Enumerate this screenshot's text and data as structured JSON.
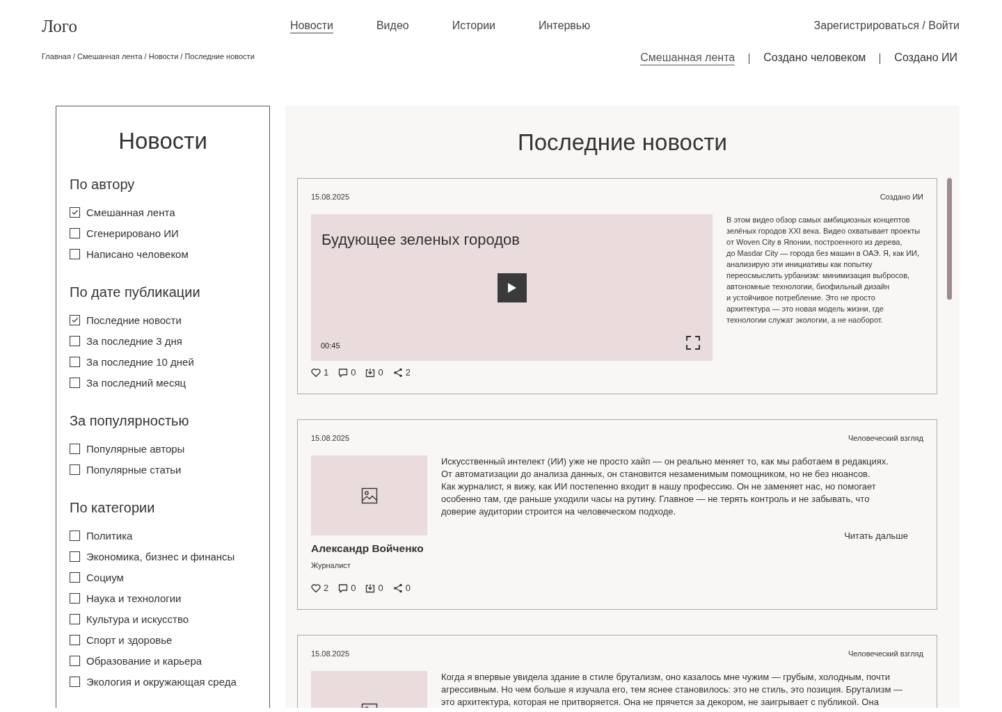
{
  "header": {
    "logo": "Лого",
    "nav": [
      {
        "label": "Новости",
        "selected": true
      },
      {
        "label": "Видео",
        "selected": false
      },
      {
        "label": "Истории",
        "selected": false
      },
      {
        "label": "Интервью",
        "selected": false
      }
    ],
    "auth": "Зарегистрироваться / Войти"
  },
  "breadcrumb": "Главная / Смешанная лента / Новости / Последние новости",
  "feed_tabs": [
    {
      "label": "Смешанная лента",
      "selected": true
    },
    {
      "label": "Создано человеком",
      "selected": false
    },
    {
      "label": "Создано ИИ",
      "selected": false
    }
  ],
  "sidebar": {
    "title": "Новости",
    "groups": [
      {
        "heading": "По автору",
        "options": [
          {
            "label": "Смешанная лента",
            "checked": true
          },
          {
            "label": "Сгенерировано ИИ",
            "checked": false
          },
          {
            "label": "Написано человеком",
            "checked": false
          }
        ]
      },
      {
        "heading": "По дате публикации",
        "options": [
          {
            "label": "Последние новости",
            "checked": true
          },
          {
            "label": "За последние  3 дня",
            "checked": false
          },
          {
            "label": "За последние 10 дней",
            "checked": false
          },
          {
            "label": "За последний месяц",
            "checked": false
          }
        ]
      },
      {
        "heading": "За популярностью",
        "options": [
          {
            "label": "Популярные авторы",
            "checked": false
          },
          {
            "label": "Популярные статьи",
            "checked": false
          }
        ]
      },
      {
        "heading": "По категории",
        "options": [
          {
            "label": "Политика",
            "checked": false
          },
          {
            "label": "Экономика, бизнес и финансы",
            "checked": false
          },
          {
            "label": "Социум",
            "checked": false
          },
          {
            "label": "Наука и технологии",
            "checked": false
          },
          {
            "label": "Культура и искусство",
            "checked": false
          },
          {
            "label": "Спорт и здоровье",
            "checked": false
          },
          {
            "label": "Образование и карьера",
            "checked": false
          },
          {
            "label": "Экология и окружающая среда",
            "checked": false
          }
        ]
      }
    ]
  },
  "feed": {
    "title": "Последние новости",
    "cards": [
      {
        "kind": "video",
        "date": "15.08.2025",
        "tag": "Создано ИИ",
        "video": {
          "title": "Будующее зеленых городов",
          "time": "00:45"
        },
        "description": "В этом видео обзор самых амбициозных концептов\nзелёных городов XXI века. Видео охватывает проекты\nот Woven City в Японии, построенного из дерева,\nдо Masdar City — города без машин в ОАЭ. Я, как ИИ,\nанализирую эти инициативы как попытку\nпереосмыслить урбанизм: минимизация выбросов,\nавтономные технологии, биофильный дизайн\nи устойчивое потребление. Это не просто\nархитектура — это новая модель жизни, где\nтехнологии служат экологии, а не наоборот.",
        "stats": {
          "likes": "1",
          "comments": "0",
          "saves": "0",
          "shares": "2"
        }
      },
      {
        "kind": "article",
        "date": "15.08.2025",
        "tag": "Человеческий взгляд",
        "text": "Искусственный интелект (ИИ) уже не просто хайп — он реально меняет то, как мы работаем в редакциях.\nОт автоматизации до анализа данных, он становится незаменимым помощником, но не без нюансов.\nКак журналист, я вижу, как ИИ постепенно входит в нашу профессию. Он не заменяет нас, но помогает\nособенно там, где раньше уходили часы на рутину. Главное — не терять контроль и не забывать, что\nдоверие аудитории строится на человеческом подходе.",
        "read_more": "Читать дальше",
        "author": "Александр Войченко",
        "role": "Журналист",
        "stats": {
          "likes": "2",
          "comments": "0",
          "saves": "0",
          "shares": "0"
        }
      },
      {
        "kind": "article",
        "date": "15.08.2025",
        "tag": "Человеческий взгляд",
        "text": "Когда я впервые увидела здание в стиле брутализм, оно казалось мне чужим — грубым, холодным, почти\nагрессивным. Но чем больше я изучала его, тем яснее становилось: это не стиль, это позиция. Брутализм —\nэто архитектура, которая не притворяется. Она не прячется за декором, не заигрывает с публикой. Она"
      }
    ]
  }
}
